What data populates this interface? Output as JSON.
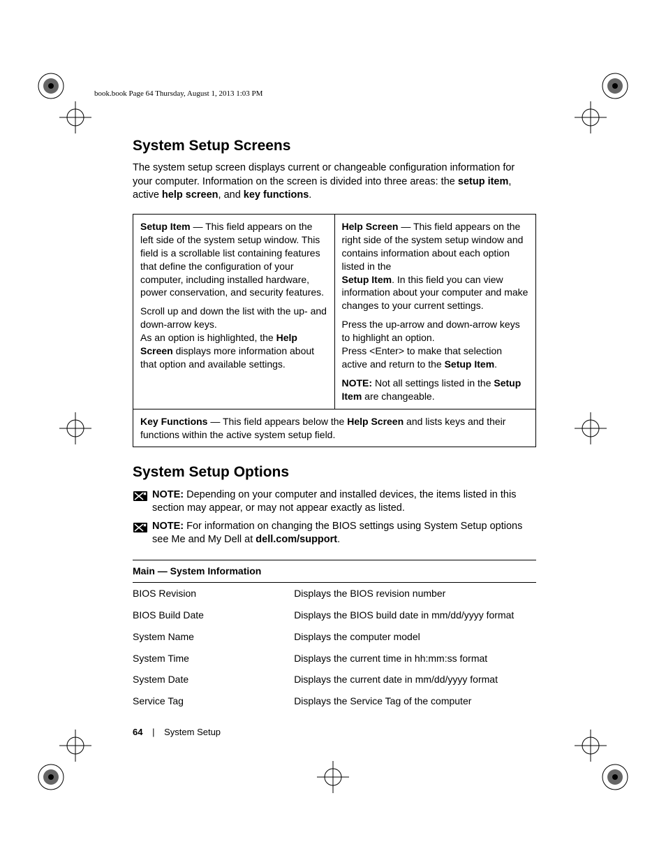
{
  "header": "book.book  Page 64  Thursday, August 1, 2013  1:03 PM",
  "h1": "System Setup Screens",
  "intro1a": "The system setup screen displays current or changeable configuration information for your computer. Information on the screen is divided into three areas: the ",
  "intro1b": "setup item",
  "intro1c": ", active ",
  "intro1d": "help screen",
  "intro1e": ", and ",
  "intro1f": "key functions",
  "intro1g": ".",
  "cell_left_p1a": "Setup Item",
  "cell_left_p1b": " — This field appears on the left side of the system setup window. This field is a scrollable list containing features that define the configuration of your computer, including installed hardware, power conservation, and security features.",
  "cell_left_p2a": "Scroll up and down the list with the up- and down-arrow keys.",
  "cell_left_p2b": "As an option is highlighted, the ",
  "cell_left_p2c": "Help Screen",
  "cell_left_p2d": " displays more information about that option and available settings.",
  "cell_right_p1a": "Help Screen",
  "cell_right_p1b": " — This field appears on the right side of the system setup window and contains information about each option listed in the",
  "cell_right_p1c": "Setup Item",
  "cell_right_p1d": ". In this field you can view information about your computer and make changes to your current settings.",
  "cell_right_p2a": "Press the up-arrow and down-arrow keys to highlight an option.",
  "cell_right_p2b": "Press <Enter> to make that selection active and return to the ",
  "cell_right_p2c": "Setup Item",
  "cell_right_p2d": ".",
  "cell_right_p3a": "NOTE:",
  "cell_right_p3b": " Not all settings listed in the ",
  "cell_right_p3c": "Setup Item",
  "cell_right_p3d": " are changeable.",
  "cell_bottom_a": "Key Functions",
  "cell_bottom_b": " — This field appears below the ",
  "cell_bottom_c": "Help Screen",
  "cell_bottom_d": " and lists keys and their functions within the active system setup field.",
  "h2": "System Setup Options",
  "note1a": "NOTE:",
  "note1b": " Depending on your computer and installed devices, the items listed in this section may appear, or may not appear exactly as listed.",
  "note2a": "NOTE:",
  "note2b": " For information on changing the BIOS settings using System Setup options see Me and My Dell at ",
  "note2c": "dell.com/support",
  "note2d": ".",
  "table_header": "Main — System Information",
  "rows": [
    {
      "k": "BIOS Revision",
      "v": "Displays the BIOS revision number"
    },
    {
      "k": "BIOS Build Date",
      "v": "Displays the BIOS build date in mm/dd/yyyy format"
    },
    {
      "k": "System Name",
      "v": "Displays the computer model"
    },
    {
      "k": "System Time",
      "v": "Displays the current time in hh:mm:ss format"
    },
    {
      "k": "System Date",
      "v": "Displays the current date in mm/dd/yyyy format"
    },
    {
      "k": "Service Tag",
      "v": "Displays the Service Tag of the computer"
    }
  ],
  "footer_page": "64",
  "footer_sep": "|",
  "footer_section": "System Setup"
}
